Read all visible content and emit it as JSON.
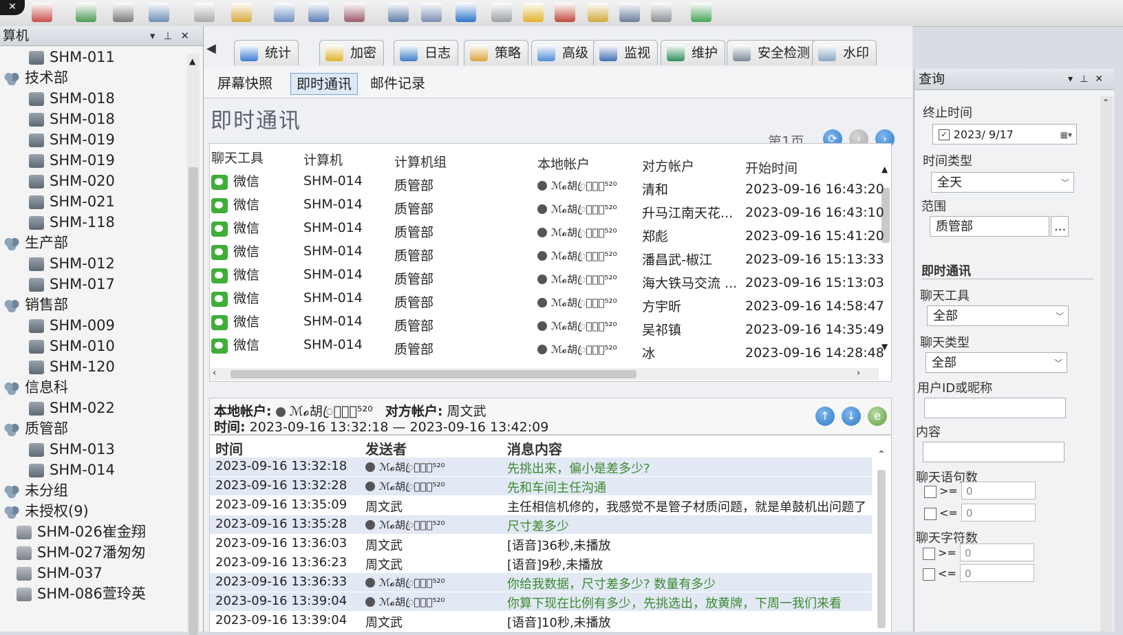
{
  "toolbar": {
    "icons": [
      "close-icon",
      "delete-icon",
      "export-icon",
      "printer-icon",
      "find-icon",
      "user-icon",
      "note-icon",
      "copy-icon",
      "search-icon",
      "edit-icon",
      "monitor-icon",
      "window-icon",
      "globe-icon",
      "drive-icon",
      "warning-icon",
      "chart-icon",
      "lock-icon",
      "notepad-icon",
      "phone-icon",
      "refresh-icon"
    ]
  },
  "left_panel": {
    "title": "算机",
    "tree": [
      {
        "label": "SHM-011",
        "kind": "pc",
        "indent": 2
      },
      {
        "label": "技术部",
        "kind": "group",
        "indent": 0
      },
      {
        "label": "SHM-018",
        "kind": "pc",
        "indent": 2
      },
      {
        "label": "SHM-018",
        "kind": "pc",
        "indent": 2
      },
      {
        "label": "SHM-019",
        "kind": "pc",
        "indent": 2
      },
      {
        "label": "SHM-019",
        "kind": "pc",
        "indent": 2
      },
      {
        "label": "SHM-020",
        "kind": "pc",
        "indent": 2
      },
      {
        "label": "SHM-021",
        "kind": "pc",
        "indent": 2
      },
      {
        "label": "SHM-118",
        "kind": "pc",
        "indent": 2
      },
      {
        "label": "生产部",
        "kind": "group",
        "indent": 0
      },
      {
        "label": "SHM-012",
        "kind": "pc",
        "indent": 2
      },
      {
        "label": "SHM-017",
        "kind": "pc",
        "indent": 2
      },
      {
        "label": "销售部",
        "kind": "group",
        "indent": 0
      },
      {
        "label": "SHM-009",
        "kind": "pc",
        "indent": 2
      },
      {
        "label": "SHM-010",
        "kind": "pc",
        "indent": 2
      },
      {
        "label": "SHM-120",
        "kind": "pc",
        "indent": 2
      },
      {
        "label": "信息科",
        "kind": "group",
        "indent": 0
      },
      {
        "label": "SHM-022",
        "kind": "pc",
        "indent": 2
      },
      {
        "label": "质管部",
        "kind": "group",
        "indent": 0
      },
      {
        "label": "SHM-013",
        "kind": "pc",
        "indent": 2
      },
      {
        "label": "SHM-014",
        "kind": "pc",
        "indent": 2
      },
      {
        "label": "未分组",
        "kind": "group",
        "indent": 0
      },
      {
        "label": "未授权(9)",
        "kind": "unauth-group",
        "indent": 0
      },
      {
        "label": "SHM-026崔金翔",
        "kind": "unauth",
        "indent": 1
      },
      {
        "label": "SHM-027潘匆匆",
        "kind": "unauth",
        "indent": 1
      },
      {
        "label": "SHM-037",
        "kind": "unauth",
        "indent": 1
      },
      {
        "label": "SHM-086萱玲英",
        "kind": "unauth",
        "indent": 1
      }
    ]
  },
  "tabs": [
    {
      "label": "统计",
      "color": "#3a7bd5"
    },
    {
      "label": "加密",
      "color": "#e0b12c"
    },
    {
      "label": "日志",
      "color": "#3f7fc9"
    },
    {
      "label": "策略",
      "color": "#d9a441"
    },
    {
      "label": "高级",
      "color": "#4f8fd8"
    },
    {
      "label": "监视",
      "color": "#3f6fb5"
    },
    {
      "label": "维护",
      "color": "#2f8f5a"
    },
    {
      "label": "安全检测",
      "color": "#7b8a99"
    },
    {
      "label": "水印",
      "color": "#8aa6c4"
    }
  ],
  "subtabs": [
    "屏幕快照",
    "即时通讯",
    "邮件记录"
  ],
  "view_title": "即时通讯",
  "pager": {
    "label": "第1页"
  },
  "sessions": {
    "columns": [
      "聊天工具",
      "计算机",
      "计算机组",
      "本地帐户",
      "对方帐户",
      "开始时间"
    ],
    "rows": [
      {
        "tool": "微信",
        "pc": "SHM-014",
        "group": "质管部",
        "local": "ℳ𝓸胡ꦿ𝓶ꦿ𝓹⁵²⁰",
        "remote": "清和",
        "start": "2023-09-16 16:43:20"
      },
      {
        "tool": "微信",
        "pc": "SHM-014",
        "group": "质管部",
        "local": "ℳ𝓸胡ꦿ𝓶ꦿ𝓹⁵²⁰",
        "remote": "升马江南天花...",
        "start": "2023-09-16 16:43:10"
      },
      {
        "tool": "微信",
        "pc": "SHM-014",
        "group": "质管部",
        "local": "ℳ𝓸胡ꦿ𝓶ꦿ𝓹⁵²⁰",
        "remote": "郑彪",
        "start": "2023-09-16 15:41:20"
      },
      {
        "tool": "微信",
        "pc": "SHM-014",
        "group": "质管部",
        "local": "ℳ𝓸胡ꦿ𝓶ꦿ𝓹⁵²⁰",
        "remote": "潘昌武-椒江",
        "start": "2023-09-16 15:13:33"
      },
      {
        "tool": "微信",
        "pc": "SHM-014",
        "group": "质管部",
        "local": "ℳ𝓸胡ꦿ𝓶ꦿ𝓹⁵²⁰",
        "remote": "海大铁马交流 ...",
        "start": "2023-09-16 15:13:03"
      },
      {
        "tool": "微信",
        "pc": "SHM-014",
        "group": "质管部",
        "local": "ℳ𝓸胡ꦿ𝓶ꦿ𝓹⁵²⁰",
        "remote": "方宇昕",
        "start": "2023-09-16 14:58:47"
      },
      {
        "tool": "微信",
        "pc": "SHM-014",
        "group": "质管部",
        "local": "ℳ𝓸胡ꦿ𝓶ꦿ𝓹⁵²⁰",
        "remote": "吴祁镇",
        "start": "2023-09-16 14:35:49"
      },
      {
        "tool": "微信",
        "pc": "SHM-014",
        "group": "质管部",
        "local": "ℳ𝓸胡ꦿ𝓶ꦿ𝓹⁵²⁰",
        "remote": "冰",
        "start": "2023-09-16 14:28:48"
      }
    ]
  },
  "detail": {
    "local_label": "本地帐户:",
    "local_value": "ℳ𝓸胡ꦿ𝓶ꦿ𝓹⁵²⁰",
    "remote_label": "对方帐户:",
    "remote_value": "周文武",
    "time_label": "时间:",
    "time_value": "2023-09-16 13:32:18 — 2023-09-16 13:42:09"
  },
  "messages": {
    "columns": [
      "时间",
      "发送者",
      "消息内容"
    ],
    "rows": [
      {
        "time": "2023-09-16 13:32:18",
        "sender": "ℳ𝓸胡ꦿ𝓶ꦿ𝓹⁵²⁰",
        "self": true,
        "content": "先挑出来，偏小是差多少?"
      },
      {
        "time": "2023-09-16 13:32:28",
        "sender": "ℳ𝓸胡ꦿ𝓶ꦿ𝓹⁵²⁰",
        "self": true,
        "content": "先和车间主任沟通"
      },
      {
        "time": "2023-09-16 13:35:09",
        "sender": "周文武",
        "self": false,
        "content": "主任相信机修的，我感觉不是管子材质问题，就是单鼓机出问题了"
      },
      {
        "time": "2023-09-16 13:35:28",
        "sender": "ℳ𝓸胡ꦿ𝓶ꦿ𝓹⁵²⁰",
        "self": true,
        "content": "尺寸差多少"
      },
      {
        "time": "2023-09-16 13:36:03",
        "sender": "周文武",
        "self": false,
        "content": "[语音]36秒,未播放"
      },
      {
        "time": "2023-09-16 13:36:23",
        "sender": "周文武",
        "self": false,
        "content": "[语音]9秒,未播放"
      },
      {
        "time": "2023-09-16 13:36:33",
        "sender": "ℳ𝓸胡ꦿ𝓶ꦿ𝓹⁵²⁰",
        "self": true,
        "content": "你给我数据，尺寸差多少? 数量有多少"
      },
      {
        "time": "2023-09-16 13:39:04",
        "sender": "ℳ𝓸胡ꦿ𝓶ꦿ𝓹⁵²⁰",
        "self": true,
        "content": "你算下现在比例有多少，先挑选出，放黄牌，下周一我们来看"
      },
      {
        "time": "2023-09-16 13:39:04",
        "sender": "周文武",
        "self": false,
        "content": "[语音]10秒,未播放"
      }
    ]
  },
  "query": {
    "title": "查询",
    "end_time_label": "终止时间",
    "end_time_value": "2023/ 9/17",
    "time_type_label": "时间类型",
    "time_type_value": "全天",
    "range_label": "范围",
    "range_value": "质管部",
    "range_btn": "...",
    "section_im": "即时通讯",
    "tool_label": "聊天工具",
    "tool_value": "全部",
    "chat_type_label": "聊天类型",
    "chat_type_value": "全部",
    "user_label": "用户ID或昵称",
    "content_label": "内容",
    "sentences_label": "聊天语句数",
    "chars_label": "聊天字符数",
    "ge": ">=",
    "le": "<=",
    "zero": "0"
  }
}
